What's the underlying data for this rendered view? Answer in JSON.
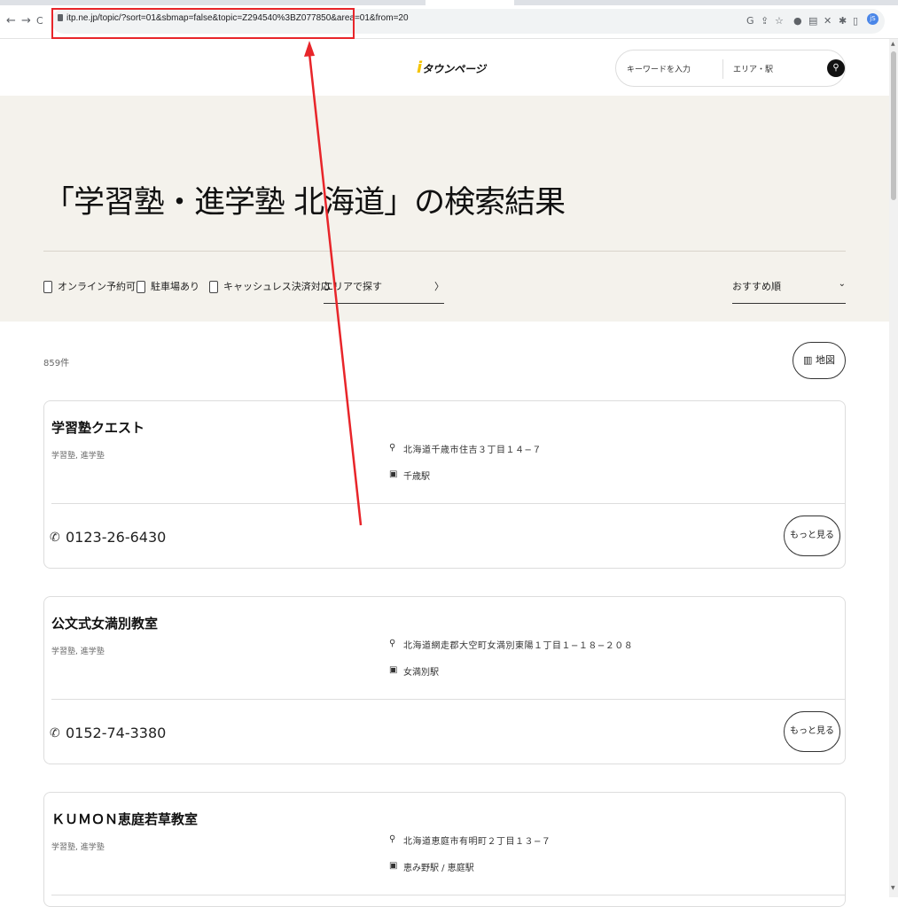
{
  "browser": {
    "url": "itp.ne.jp/topic/?sort=01&sbmap=false&topic=Z294540%3BZ077850&area=01&from=20",
    "back_icon": "←",
    "forward_icon": "→",
    "reload_icon": "C",
    "avatar_text": "jS"
  },
  "header": {
    "logo_prefix": "i",
    "logo_text": "タウンページ",
    "search_keyword_placeholder": "キーワードを入力",
    "search_area_placeholder": "エリア・駅"
  },
  "hero": {
    "title": "「学習塾・進学塾 北海道」の検索結果",
    "filters": [
      "オンライン予約可",
      "駐車場あり",
      "キャッシュレス決済対応"
    ],
    "area_select": "エリアで探す",
    "sort_select": "おすすめ順"
  },
  "results": {
    "count": "859件",
    "map_button": "地図",
    "more_label": "もっと見る",
    "items": [
      {
        "name": "学習塾クエスト",
        "category": "学習塾, 進学塾",
        "address": "北海道千歳市住吉３丁目１４−７",
        "station": "千歳駅",
        "phone": "0123-26-6430"
      },
      {
        "name": "公文式女満別教室",
        "category": "学習塾, 進学塾",
        "address": "北海道網走郡大空町女満別東陽１丁目１−１８−２０８",
        "station": "女満別駅",
        "phone": "0152-74-3380"
      },
      {
        "name": "ＫＵＭＯＮ恵庭若草教室",
        "category": "学習塾, 進学塾",
        "address": "北海道恵庭市有明町２丁目１３−７",
        "station": "恵み野駅 / 恵庭駅",
        "phone": ""
      }
    ]
  },
  "colors": {
    "hero_bg": "#f4f2ec",
    "annotation": "#e8252a",
    "logo_accent": "#f5c400"
  }
}
